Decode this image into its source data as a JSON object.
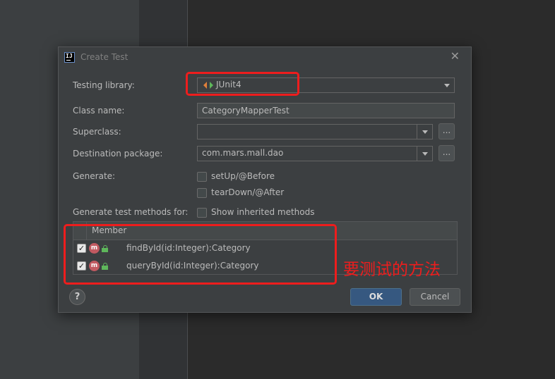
{
  "dialog": {
    "title": "Create Test",
    "testing_library": {
      "label": "Testing library:",
      "value": "JUnit4"
    },
    "class_name": {
      "label": "Class name:",
      "value": "CategoryMapperTest"
    },
    "superclass": {
      "label": "Superclass:",
      "value": "",
      "browse_label": "..."
    },
    "destination_package": {
      "label": "Destination package:",
      "value": "com.mars.mall.dao",
      "browse_label": "..."
    },
    "generate": {
      "label": "Generate:",
      "options": [
        {
          "label": "setUp/@Before",
          "checked": false
        },
        {
          "label": "tearDown/@After",
          "checked": false
        }
      ]
    },
    "methods_for": {
      "label": "Generate test methods for:",
      "show_inherited_label": "Show inherited methods",
      "show_inherited_checked": false
    },
    "table": {
      "header": "Member",
      "rows": [
        {
          "checked": true,
          "icon_letter": "m",
          "text": "findById(id:Integer):Category"
        },
        {
          "checked": true,
          "icon_letter": "m",
          "text": "queryById(id:Integer):Category"
        }
      ]
    },
    "help_label": "?",
    "ok_label": "OK",
    "cancel_label": "Cancel"
  },
  "annotation": {
    "text": "要测试的方法",
    "color": "#ee1d1d"
  },
  "colors": {
    "accent": "#365880",
    "annotation": "#ee1d1d",
    "method_icon": "#c25a61",
    "lock": "#5eb75b"
  },
  "icons": [
    "app-icon",
    "close-icon",
    "junit-icon",
    "chevron-down-icon",
    "method-icon",
    "unlock-icon",
    "help-icon",
    "check-icon"
  ]
}
